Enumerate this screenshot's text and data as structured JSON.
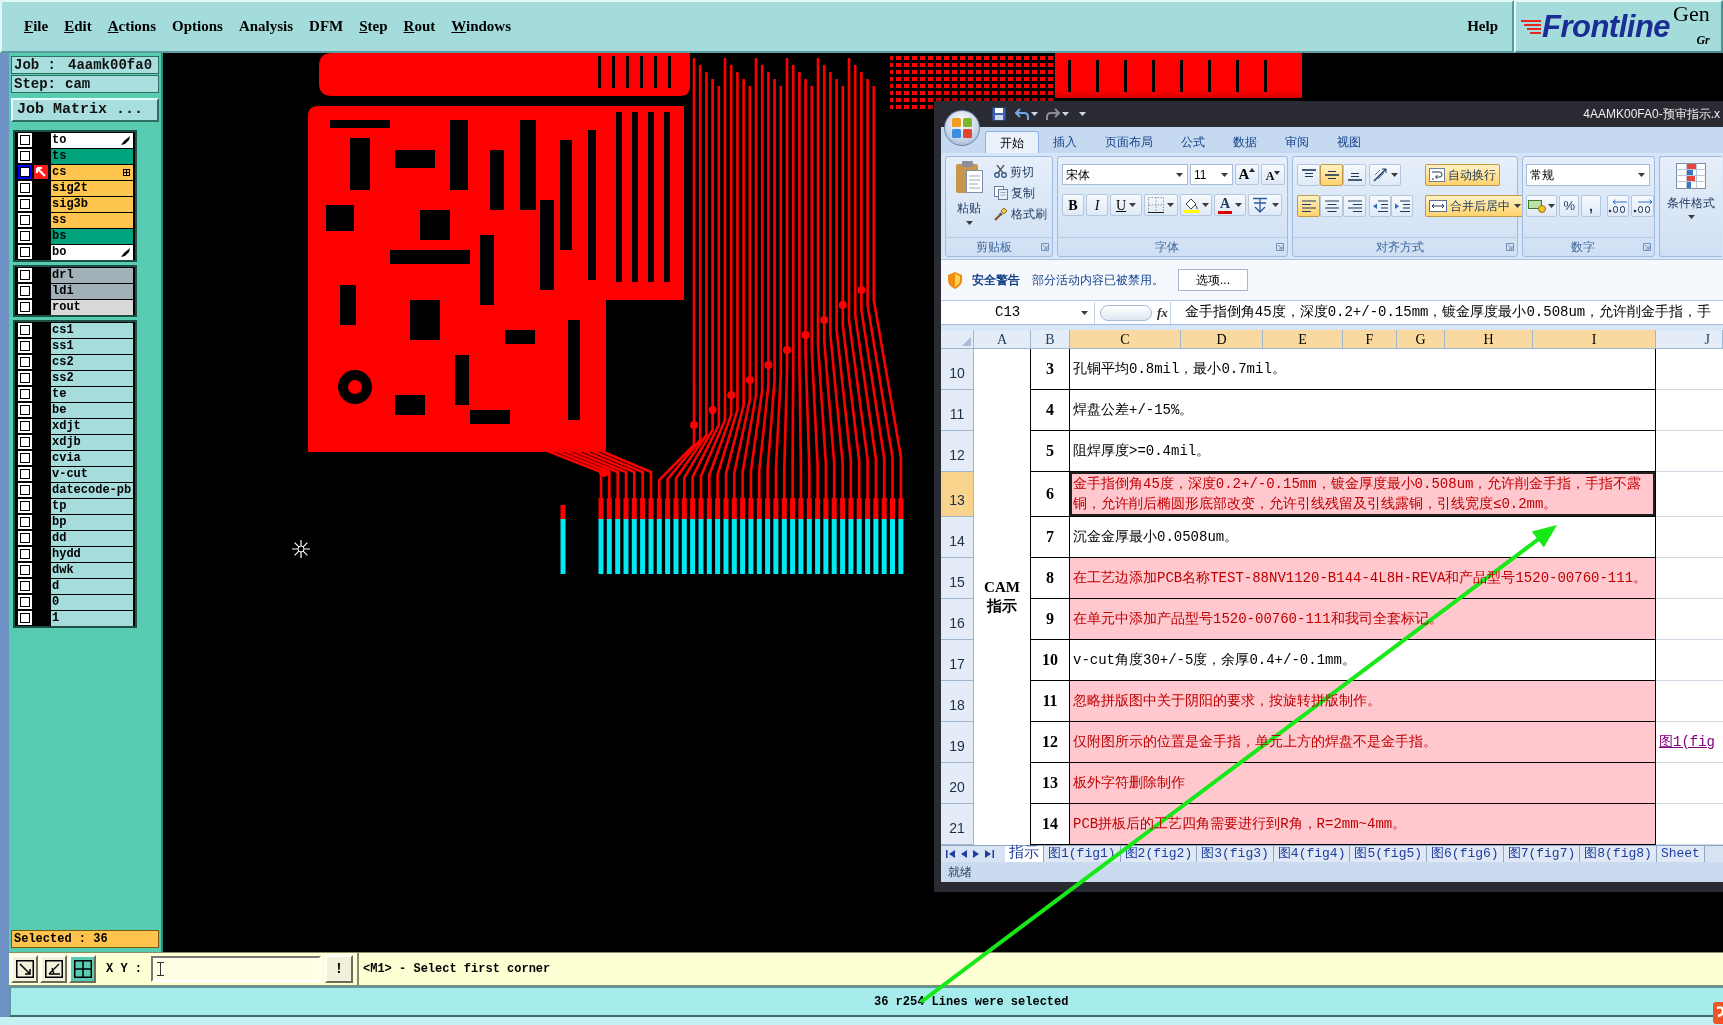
{
  "menu_bar": {
    "items": [
      {
        "label": "File",
        "mnemonic": true
      },
      {
        "label": "Edit",
        "mnemonic": true
      },
      {
        "label": "Actions",
        "mnemonic": true
      },
      {
        "label": "Options",
        "mnemonic": false
      },
      {
        "label": "Analysis",
        "mnemonic": false
      },
      {
        "label": "DFM",
        "mnemonic": false
      },
      {
        "label": "Step",
        "mnemonic": true
      },
      {
        "label": "Rout",
        "mnemonic": true
      },
      {
        "label": "Windows",
        "mnemonic": true
      }
    ],
    "help": "Help"
  },
  "logo": {
    "brand": "Frontline",
    "product": "Gen",
    "tagline": "Gr"
  },
  "left_panel": {
    "job_label": "Job :",
    "job": "4aamk00fa0",
    "step_label": "Step:",
    "step": "cam",
    "matrix_button": "Job Matrix ...",
    "layer_groups": [
      {
        "layers": [
          {
            "name": "to",
            "color": "#ffffff",
            "checked": false,
            "selected": false,
            "kind": "marked"
          },
          {
            "name": "ts",
            "color": "#00a37b",
            "checked": false,
            "selected": false,
            "kind": "plain"
          },
          {
            "name": "cs",
            "color": "#ffc54f",
            "checked": false,
            "selected": true,
            "kind": "boxed"
          },
          {
            "name": "sig2t",
            "color": "#ffc54f",
            "checked": false,
            "selected": false,
            "kind": "plain"
          },
          {
            "name": "sig3b",
            "color": "#ffc54f",
            "checked": false,
            "selected": false,
            "kind": "plain"
          },
          {
            "name": "ss",
            "color": "#ffc54f",
            "checked": false,
            "selected": false,
            "kind": "plain"
          },
          {
            "name": "bs",
            "color": "#00a37b",
            "checked": false,
            "selected": false,
            "kind": "plain"
          },
          {
            "name": "bo",
            "color": "#ffffff",
            "checked": false,
            "selected": false,
            "kind": "marked"
          }
        ]
      },
      {
        "layers": [
          {
            "name": "drl",
            "color": "#a2b1b8",
            "checked": false,
            "selected": false,
            "kind": "plain"
          },
          {
            "name": "ldi",
            "color": "#a2b1b8",
            "checked": false,
            "selected": false,
            "kind": "plain"
          },
          {
            "name": "rout",
            "color": "#d9d9d9",
            "checked": false,
            "selected": false,
            "kind": "plain"
          }
        ]
      },
      {
        "layers": [
          {
            "name": "cs1",
            "color": "#a6dcdc",
            "checked": false,
            "selected": false,
            "kind": "plain"
          },
          {
            "name": "ss1",
            "color": "#a6dcdc",
            "checked": false,
            "selected": false,
            "kind": "plain"
          },
          {
            "name": "cs2",
            "color": "#a6dcdc",
            "checked": false,
            "selected": false,
            "kind": "plain"
          },
          {
            "name": "ss2",
            "color": "#a6dcdc",
            "checked": false,
            "selected": false,
            "kind": "plain"
          },
          {
            "name": "te",
            "color": "#a6dcdc",
            "checked": false,
            "selected": false,
            "kind": "plain"
          },
          {
            "name": "be",
            "color": "#a6dcdc",
            "checked": false,
            "selected": false,
            "kind": "plain"
          },
          {
            "name": "xdjt",
            "color": "#a6dcdc",
            "checked": false,
            "selected": false,
            "kind": "plain"
          },
          {
            "name": "xdjb",
            "color": "#a6dcdc",
            "checked": false,
            "selected": false,
            "kind": "plain"
          },
          {
            "name": "cvia",
            "color": "#a6dcdc",
            "checked": false,
            "selected": false,
            "kind": "plain"
          },
          {
            "name": "v-cut",
            "color": "#a6dcdc",
            "checked": false,
            "selected": false,
            "kind": "plain"
          },
          {
            "name": "datecode-pb",
            "color": "#a6dcdc",
            "checked": false,
            "selected": false,
            "kind": "plain"
          },
          {
            "name": "tp",
            "color": "#a6dcdc",
            "checked": false,
            "selected": false,
            "kind": "plain"
          },
          {
            "name": "bp",
            "color": "#a6dcdc",
            "checked": false,
            "selected": false,
            "kind": "plain"
          },
          {
            "name": "dd",
            "color": "#a6dcdc",
            "checked": false,
            "selected": false,
            "kind": "plain"
          },
          {
            "name": "hydd",
            "color": "#a6dcdc",
            "checked": false,
            "selected": false,
            "kind": "plain"
          },
          {
            "name": "dwk",
            "color": "#a6dcdc",
            "checked": false,
            "selected": false,
            "kind": "plain"
          },
          {
            "name": "d",
            "color": "#a6dcdc",
            "checked": false,
            "selected": false,
            "kind": "plain"
          },
          {
            "name": "0",
            "color": "#a6dcdc",
            "checked": false,
            "selected": false,
            "kind": "plain"
          },
          {
            "name": "1",
            "color": "#a6dcdc",
            "checked": false,
            "selected": false,
            "kind": "plain"
          }
        ]
      }
    ],
    "selected_count": "Selected : 36"
  },
  "excel": {
    "title": "4AAMK00FA0-预审指示.x",
    "ribbon_tabs": [
      {
        "label": "开始",
        "selected": true
      },
      {
        "label": "插入",
        "selected": false
      },
      {
        "label": "页面布局",
        "selected": false
      },
      {
        "label": "公式",
        "selected": false
      },
      {
        "label": "数据",
        "selected": false
      },
      {
        "label": "审阅",
        "selected": false
      },
      {
        "label": "视图",
        "selected": false
      }
    ],
    "ribbon": {
      "clipboard": {
        "label": "剪贴板",
        "paste": "粘贴",
        "cut": "剪切",
        "copy": "复制",
        "format_painter": "格式刷"
      },
      "font": {
        "label": "字体",
        "font_name": "宋体",
        "font_size": "11",
        "grow": "A",
        "shrink": "A",
        "bold": "B",
        "italic": "I",
        "underline": "U",
        "font_color": "A"
      },
      "alignment": {
        "label": "对齐方式",
        "vertical_buttons": [
          {
            "kind": "top",
            "selected": false
          },
          {
            "kind": "middle",
            "selected": true
          },
          {
            "kind": "bottom",
            "selected": false
          }
        ],
        "horizontal_buttons": [
          {
            "kind": "left",
            "selected": true
          },
          {
            "kind": "center",
            "selected": false
          },
          {
            "kind": "right",
            "selected": false
          }
        ],
        "wrap_text": {
          "label": "自动换行",
          "on": true
        },
        "merge": {
          "label": "合并后居中",
          "on": true
        }
      },
      "number": {
        "label": "数字",
        "format": "常规",
        "percent": "%",
        "comma": ","
      },
      "styles": {
        "conditional_format": "条件格式"
      }
    },
    "security_bar": {
      "title": "安全警告",
      "message": "部分活动内容已被禁用。",
      "button": "选项..."
    },
    "formula_bar": {
      "name_box": "C13",
      "fx": "fx",
      "formula": "金手指倒角45度，深度0.2+/-0.15mm，镀金厚度最小0.508um，允许削金手指，手"
    },
    "columns": [
      {
        "label": "A",
        "selected": false
      },
      {
        "label": "B",
        "selected": false
      },
      {
        "label": "C",
        "selected": true
      },
      {
        "label": "D",
        "selected": true
      },
      {
        "label": "E",
        "selected": true
      },
      {
        "label": "F",
        "selected": true
      },
      {
        "label": "G",
        "selected": true
      },
      {
        "label": "H",
        "selected": true
      },
      {
        "label": "I",
        "selected": true
      },
      {
        "label": "J",
        "selected": false
      }
    ],
    "merged_label": "CAM 指示",
    "rows": [
      {
        "header": "10",
        "number": "3",
        "text": "孔铜平均0.8mil，最小0.7mil。",
        "highlighted": false,
        "selected": false
      },
      {
        "header": "11",
        "number": "4",
        "text": "焊盘公差+/-15%。",
        "highlighted": false,
        "selected": false
      },
      {
        "header": "12",
        "number": "5",
        "text": "阻焊厚度>=0.4mil。",
        "highlighted": false,
        "selected": false
      },
      {
        "header": "13",
        "number": "6",
        "text": "金手指倒角45度，深度0.2+/-0.15mm，镀金厚度最小0.508um，允许削金手指，手指不露铜，允许削后椭圆形底部改变，允许引线残留及引线露铜，引线宽度≤0.2mm。",
        "highlighted": true,
        "selected": true
      },
      {
        "header": "14",
        "number": "7",
        "text": "沉金金厚最小0.0508um。",
        "highlighted": false,
        "selected": false
      },
      {
        "header": "15",
        "number": "8",
        "text": "在工艺边添加PCB名称TEST-88NV1120-B144-4L8H-REVA和产品型号1520-00760-111。",
        "highlighted": true,
        "selected": false
      },
      {
        "header": "16",
        "number": "9",
        "text": "在单元中添加产品型号1520-00760-111和我司全套标记。",
        "highlighted": true,
        "selected": false
      },
      {
        "header": "17",
        "number": "10",
        "text": "v-cut角度30+/-5度，余厚0.4+/-0.1mm。",
        "highlighted": false,
        "selected": false
      },
      {
        "header": "18",
        "number": "11",
        "text": "忽略拼版图中关于阴阳的要求，按旋转拼版制作。",
        "highlighted": true,
        "selected": false
      },
      {
        "header": "19",
        "number": "12",
        "text": "仅附图所示的位置是金手指，单元上方的焊盘不是金手指。",
        "highlighted": true,
        "selected": false,
        "link": "图1(fig"
      },
      {
        "header": "20",
        "number": "13",
        "text": "板外字符删除制作",
        "highlighted": true,
        "selected": false
      },
      {
        "header": "21",
        "number": "14",
        "text": "PCB拼板后的工艺四角需要进行到R角，R=2mm~4mm。",
        "highlighted": true,
        "selected": false
      }
    ],
    "sheet_tabs": [
      {
        "label": "指示",
        "selected": true
      },
      {
        "label": "图1(fig1)",
        "selected": false
      },
      {
        "label": "图2(fig2)",
        "selected": false
      },
      {
        "label": "图3(fig3)",
        "selected": false
      },
      {
        "label": "图4(fig4)",
        "selected": false
      },
      {
        "label": "图5(fig5)",
        "selected": false
      },
      {
        "label": "图6(fig6)",
        "selected": false
      },
      {
        "label": "图7(fig7)",
        "selected": false
      },
      {
        "label": "图8(fig8)",
        "selected": false
      },
      {
        "label": "Sheet",
        "selected": false
      }
    ],
    "status": "就绪"
  },
  "command_bar": {
    "tools": [
      {
        "kind": "diagonal",
        "selected": false
      },
      {
        "kind": "angle",
        "selected": false
      },
      {
        "kind": "grid",
        "selected": true
      }
    ],
    "xy_label": "X Y :",
    "bang_button": "!",
    "message": "<M1> - Select first corner"
  },
  "status_bar": {
    "message": "36 r254 Lines were selected"
  }
}
